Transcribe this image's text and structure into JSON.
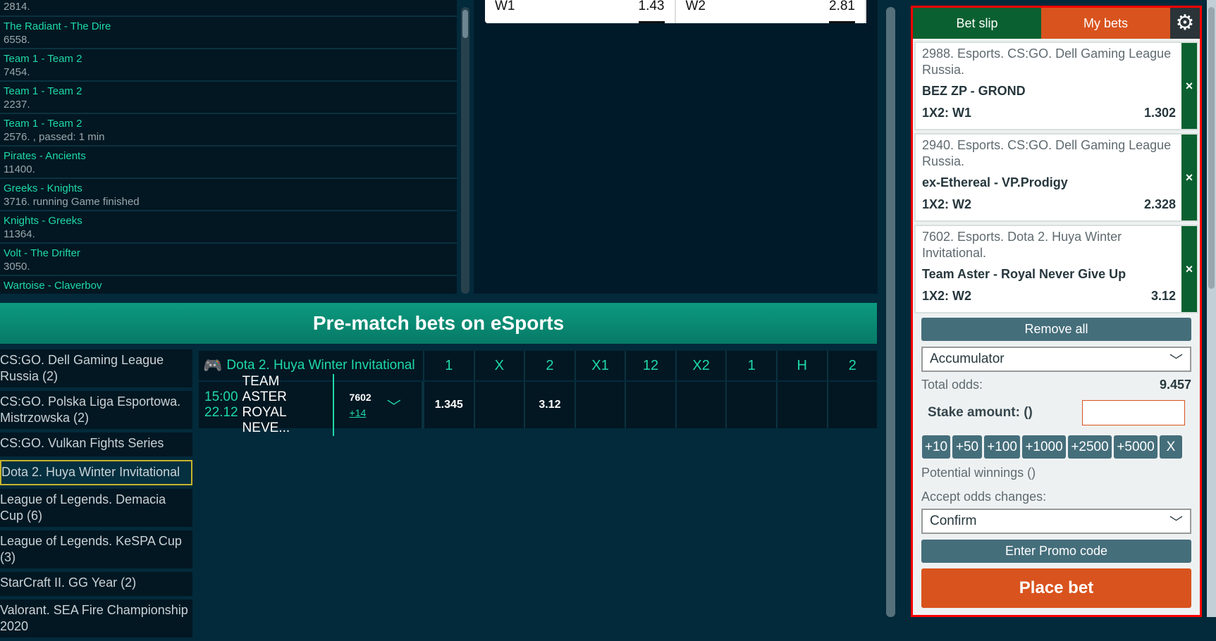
{
  "live_list": [
    {
      "teams": "",
      "info": "2814."
    },
    {
      "teams": "The Radiant - The Dire",
      "info": "6558."
    },
    {
      "teams": "Team 1 - Team 2",
      "info": "7454."
    },
    {
      "teams": "Team 1 - Team 2",
      "info": "2237."
    },
    {
      "teams": "Team 1 - Team 2",
      "info": "2576. , passed: 1 min"
    },
    {
      "teams": "Pirates - Ancients",
      "info": "11400."
    },
    {
      "teams": "Greeks - Knights",
      "info": "3716. running Game finished"
    },
    {
      "teams": "Knights - Greeks",
      "info": "11364."
    },
    {
      "teams": "Volt - The Drifter",
      "info": "3050."
    },
    {
      "teams": "Wartoise - Claverbov",
      "info": ""
    }
  ],
  "odds_box": {
    "w1_label": "W1",
    "w1": "1.43",
    "w2_label": "W2",
    "w2": "2.81"
  },
  "banner": "Pre-match bets on eSports",
  "categories": [
    "CS:GO. Dell Gaming League Russia (2)",
    "CS:GO. Polska Liga Esportowa. Mistrzowska (2)",
    "CS:GO. Vulkan Fights Series",
    "Dota 2. Huya Winter Invitational",
    "League of Legends. Demacia Cup (6)",
    "League of Legends. KeSPA Cup (3)",
    "StarCraft II. GG Year (2)",
    "Valorant. SEA Fire Championship 2020"
  ],
  "selected_category": "Dota 2. Huya Winter Invitational",
  "table": {
    "title": "Dota 2. Huya Winter Invitational",
    "columns": [
      "1",
      "X",
      "2",
      "X1",
      "12",
      "X2",
      "1",
      "H",
      "2"
    ],
    "row": {
      "time": "15:00",
      "date": "22.12",
      "team1": "TEAM ASTER",
      "team2": "ROYAL NEVE...",
      "id": "7602",
      "more": "+14",
      "odds": [
        "1.345",
        "",
        "3.12",
        "",
        "",
        "",
        "",
        "",
        ""
      ]
    }
  },
  "betslip": {
    "tab_betslip": "Bet slip",
    "tab_mybets": "My bets",
    "colors": {
      "green": "#0a6030",
      "orange": "#d9531e",
      "highlight": "#ff0000"
    },
    "bets": [
      {
        "event": "2988. Esports. CS:GO. Dell Gaming League Russia.",
        "match": "BEZ ZP - GROND",
        "market": "1X2: W1",
        "odds": "1.302"
      },
      {
        "event": "2940. Esports. CS:GO. Dell Gaming League Russia.",
        "match": "ex-Ethereal - VP.Prodigy",
        "market": "1X2: W2",
        "odds": "2.328"
      },
      {
        "event": "7602. Esports. Dota 2. Huya Winter Invitational.",
        "match": "Team Aster - Royal Never Give Up",
        "market": "1X2: W2",
        "odds": "3.12"
      }
    ],
    "remove_all": "Remove all",
    "bet_type": "Accumulator",
    "total_odds_label": "Total odds:",
    "total_odds": "9.457",
    "stake_label": "Stake amount: ()",
    "stake_value": "",
    "chips": [
      "+10",
      "+50",
      "+100",
      "+1000",
      "+2500",
      "+5000",
      "X"
    ],
    "potential": "Potential winnings ()",
    "accept_label": "Accept odds changes:",
    "accept_value": "Confirm",
    "promo": "Enter Promo code",
    "place_bet": "Place bet"
  }
}
